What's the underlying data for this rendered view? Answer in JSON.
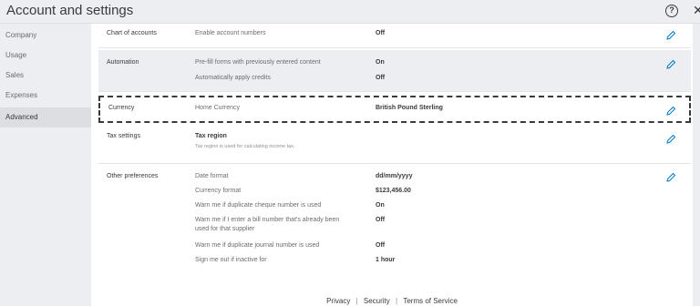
{
  "window": {
    "title": "Account and settings",
    "help_glyph": "?",
    "close_glyph": "✕"
  },
  "sidebar": {
    "items": [
      {
        "label": "Company"
      },
      {
        "label": "Usage"
      },
      {
        "label": "Sales"
      },
      {
        "label": "Expenses"
      },
      {
        "label": "Advanced",
        "active": true
      }
    ]
  },
  "sections": {
    "chart": {
      "label": "Chart of accounts",
      "fields": [
        {
          "label": "Enable account numbers",
          "value": "Off"
        }
      ]
    },
    "automation": {
      "label": "Automation",
      "fields": [
        {
          "label": "Pre-fill forms with previously entered content",
          "value": "On"
        },
        {
          "label": "Automatically apply credits",
          "value": "Off"
        }
      ]
    },
    "currency": {
      "label": "Currency",
      "fields": [
        {
          "label": "Home Currency",
          "value": "British Pound Sterling"
        }
      ]
    },
    "tax": {
      "label": "Tax settings",
      "fields": [
        {
          "label": "Tax region",
          "sub": "Tax region is used for calculating income tax."
        }
      ]
    },
    "other": {
      "label": "Other preferences",
      "fields": [
        {
          "label": "Date format",
          "value": "dd/mm/yyyy"
        },
        {
          "label": "Currency format",
          "value": "$123,456.00"
        },
        {
          "label": "Warn me if duplicate cheque number is used",
          "value": "On"
        },
        {
          "label_line1": "Warn me if I enter a bill number that's already been",
          "label_line2": "used for that supplier",
          "value": "Off"
        },
        {
          "label": "Warn me if duplicate journal number is used",
          "value": "Off"
        },
        {
          "label": "Sign me out if inactive for",
          "value": "1 hour"
        }
      ]
    }
  },
  "footer": {
    "privacy": "Privacy",
    "security": "Security",
    "terms": "Terms of Service",
    "separator": "|"
  },
  "icons": {
    "edit": "pencil-icon",
    "help": "help-icon",
    "close": "close-icon"
  },
  "colors": {
    "accent": "#0077c5",
    "text": "#393a3d",
    "sidebar_bg": "#eceef1"
  }
}
